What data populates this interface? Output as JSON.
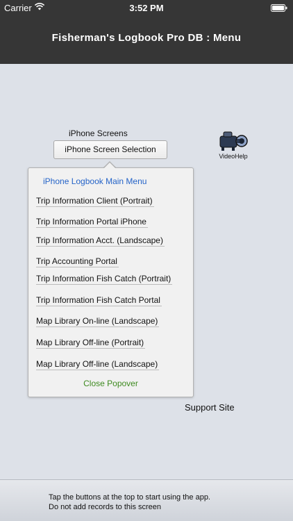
{
  "status_bar": {
    "carrier": "Carrier",
    "time": "3:52 PM",
    "wifi_icon": "wifi-icon",
    "battery_icon": "battery-icon"
  },
  "nav": {
    "title": "Fisherman's Logbook Pro DB : Menu"
  },
  "screens": {
    "label": "iPhone Screens",
    "button_label": "iPhone Screen Selection"
  },
  "video_help": {
    "icon": "video-camera-icon",
    "label": "VideoHelp"
  },
  "popover": {
    "title": "iPhone Logbook Main Menu",
    "items": [
      "Trip Information Client (Portrait)",
      "Trip Information Portal iPhone",
      "Trip Information Acct. (Landscape)",
      "Trip Accounting Portal",
      "Trip Information Fish Catch (Portrait)",
      "Trip Information Fish Catch Portal",
      "Map Library On-line (Landscape)",
      "Map Library Off-line (Portrait)",
      "Map Library Off-line (Landscape)"
    ],
    "close_label": "Close Popover"
  },
  "support_site_label": "Support Site",
  "footer": {
    "line1": "Tap the buttons at the top to start using the app.",
    "line2": "Do not add records to this screen"
  },
  "colors": {
    "header_background": "#363636",
    "page_background": "#dde1e8",
    "popover_title": "#2463c8",
    "close_popover": "#3d8a1f"
  }
}
